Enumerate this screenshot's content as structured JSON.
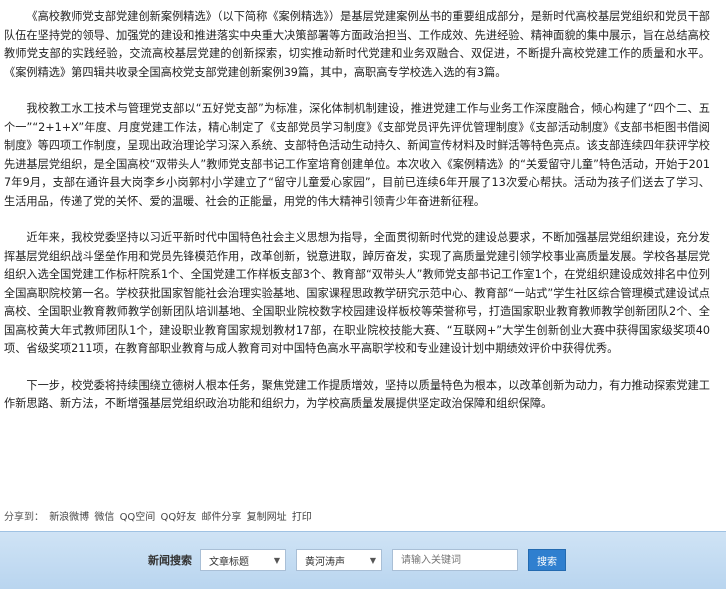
{
  "article": {
    "paragraphs": [
      "《高校教师党支部党建创新案例精选》（以下简称《案例精选》）是基层党建案例丛书的重要组成部分，是新时代高校基层党组织和党员干部队伍在坚持党的领导、加强党的建设和推进落实中央重大决策部署等方面政治担当、工作成效、先进经验、精神面貌的集中展示，旨在总结高校教师党支部的实践经验，交流高校基层党建的创新探索，切实推动新时代党建和业务双融合、双促进，不断提升高校党建工作的质量和水平。《案例精选》第四辑共收录全国高校党支部党建创新案例39篇，其中，高职高专学校选入选的有3篇。",
      "我校教工水工技术与管理党支部以“五好党支部”为标准，深化体制机制建设，推进党建工作与业务工作深度融合，倾心构建了“四个二、五个一”“2+1+X”年度、月度党建工作法，精心制定了《支部党员学习制度》《支部党员评先评优管理制度》《支部活动制度》《支部书柜图书借阅制度》等四项工作制度，呈现出政治理论学习深入系统、支部特色活动生动持久、新闻宣传材料及时鲜活等特色亮点。该支部连续四年获评学校先进基层党组织，是全国高校“双带头人”教师党支部书记工作室培育创建单位。本次收入《案例精选》的“关爱留守儿童”特色活动，开始于2017年9月，支部在通许县大岗李乡小岗郭村小学建立了“留守儿童爱心家园”，目前已连续6年开展了13次爱心帮扶。活动为孩子们送去了学习、生活用品，传递了党的关怀、爱的温暖、社会的正能量，用党的伟大精神引领青少年奋进新征程。",
      "近年来，我校党委坚持以习近平新时代中国特色社会主义思想为指导，全面贯彻新时代党的建设总要求，不断加强基层党组织建设，充分发挥基层党组织战斗堡垒作用和党员先锋模范作用，改革创新，锐意进取，踔厉奋发，实现了高质量党建引领学校事业高质量发展。学校各基层党组织入选全国党建工作标杆院系1个、全国党建工作样板支部3个、教育部“双带头人”教师党支部书记工作室1个，在党组织建设成效排名中位列全国高职院校第一名。学校获批国家智能社会治理实验基地、国家课程思政教学研究示范中心、教育部“一站式”学生社区综合管理模式建设试点高校、全国职业教育教师教学创新团队培训基地、全国职业院校数字校园建设样板校等荣誉称号，打造国家职业教育教师教学创新团队2个、全国高校黄大年式教师团队1个，建设职业教育国家规划教材17部，在职业院校技能大赛、“互联网+”大学生创新创业大赛中获得国家级奖项40项、省级奖项211项，在教育部职业教育与成人教育司对中国特色高水平高职学校和专业建设计划中期绩效评价中获得优秀。",
      "下一步，校党委将持续围绕立德树人根本任务，聚焦党建工作提质增效，坚持以质量特色为根本，以改革创新为动力，有力推动探索党建工作新思路、新方法，不断增强基层党组织政治功能和组织力，为学校高质量发展提供坚定政治保障和组织保障。"
    ]
  },
  "share": {
    "label": "分享到：",
    "links": [
      "新浪微博",
      "微信",
      "QQ空间",
      "QQ好友",
      "邮件分享",
      "复制网址",
      "打印"
    ]
  },
  "search": {
    "label": "新闻搜索",
    "field_select": "文章标题",
    "site_select": "黄河涛声",
    "keyword_placeholder": "请输入关键词",
    "button_label": "搜索"
  }
}
